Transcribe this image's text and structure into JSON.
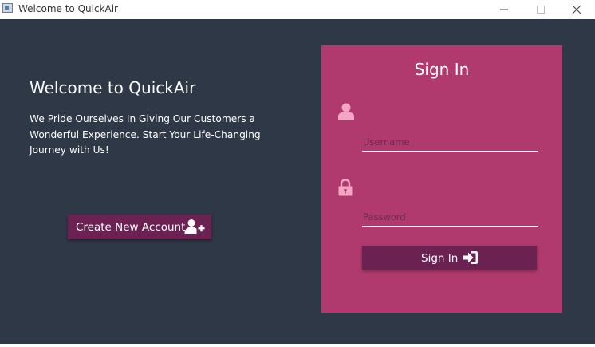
{
  "window": {
    "title": "Welcome to QuickAir"
  },
  "welcome": {
    "title": "Welcome to QuickAir",
    "text": "We Pride Ourselves In Giving Our Customers a Wonderful Experience. Start Your Life-Changing Journey with Us!",
    "create_account_label": "Create New Account",
    "create_account_icon": "add-user-icon"
  },
  "signin": {
    "title": "Sign In",
    "username_placeholder": "Username",
    "password_placeholder": "Password",
    "username_icon": "user-icon",
    "password_icon": "lock-icon",
    "button_label": "Sign In",
    "button_icon": "sign-in-icon"
  },
  "colors": {
    "background": "#2e3846",
    "panel": "#b03a6d",
    "button": "#6b2253",
    "icon_accent": "#f3a6c3"
  }
}
